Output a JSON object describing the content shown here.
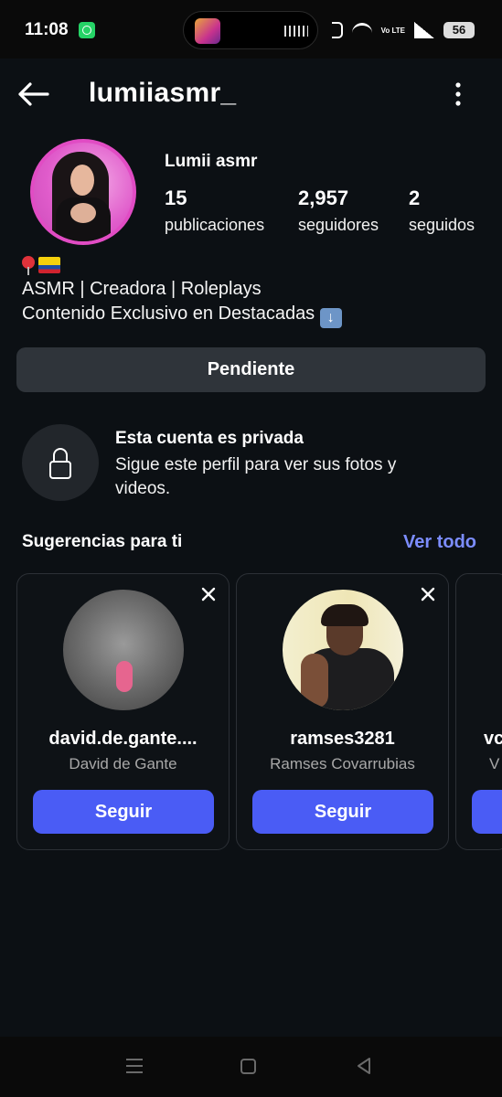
{
  "status_bar": {
    "time": "11:08",
    "network_label": "Vo LTE",
    "battery": "56"
  },
  "header": {
    "username": "lumiiasmr_"
  },
  "profile": {
    "display_name": "Lumii asmr",
    "stats": [
      {
        "value": "15",
        "label": "publicaciones"
      },
      {
        "value": "2,957",
        "label": "seguidores"
      },
      {
        "value": "2",
        "label": "seguidos"
      }
    ],
    "bio_line1": "ASMR | Creadora | Roleplays",
    "bio_line2": "Contenido Exclusivo en Destacadas",
    "bio_icons": [
      "pin-icon",
      "colombia-flag-icon",
      "arrow-down-icon"
    ]
  },
  "pending_button": "Pendiente",
  "private": {
    "title": "Esta cuenta es privada",
    "description": "Sigue este perfil para ver sus fotos y videos."
  },
  "suggestions": {
    "title": "Sugerencias para ti",
    "see_all": "Ver todo",
    "cards": [
      {
        "username": "david.de.gante....",
        "name": "David de Gante",
        "button": "Seguir"
      },
      {
        "username": "ramses3281",
        "name": "Ramses Covarrubias",
        "button": "Seguir"
      },
      {
        "username": "vc",
        "name": "V"
      }
    ]
  },
  "colors": {
    "background": "#0c1014",
    "accent_button": "#4a5cf5",
    "link": "#7c8dff",
    "avatar_ring": "#e14cc4"
  }
}
